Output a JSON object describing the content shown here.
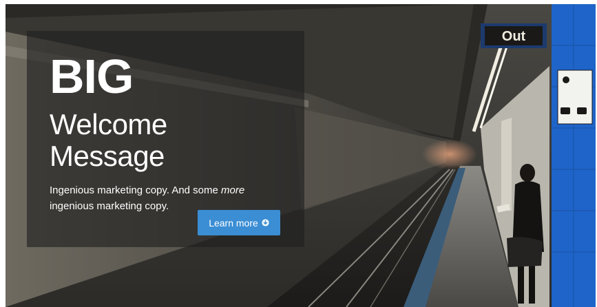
{
  "hero": {
    "headline": "BIG",
    "subheadline": "Welcome Message",
    "copy": {
      "part1": "Ingenious marketing copy. And some ",
      "emphasis": "more",
      "part2": " ingenious marketing copy."
    },
    "cta_label": "Learn more"
  },
  "scene": {
    "exit_sign": "Out"
  },
  "icons": {
    "cta": "arrow-circle-down-icon"
  },
  "colors": {
    "cta_background": "#3b8ed4",
    "text": "#ffffff",
    "pillar_blue": "#1f64c8"
  }
}
